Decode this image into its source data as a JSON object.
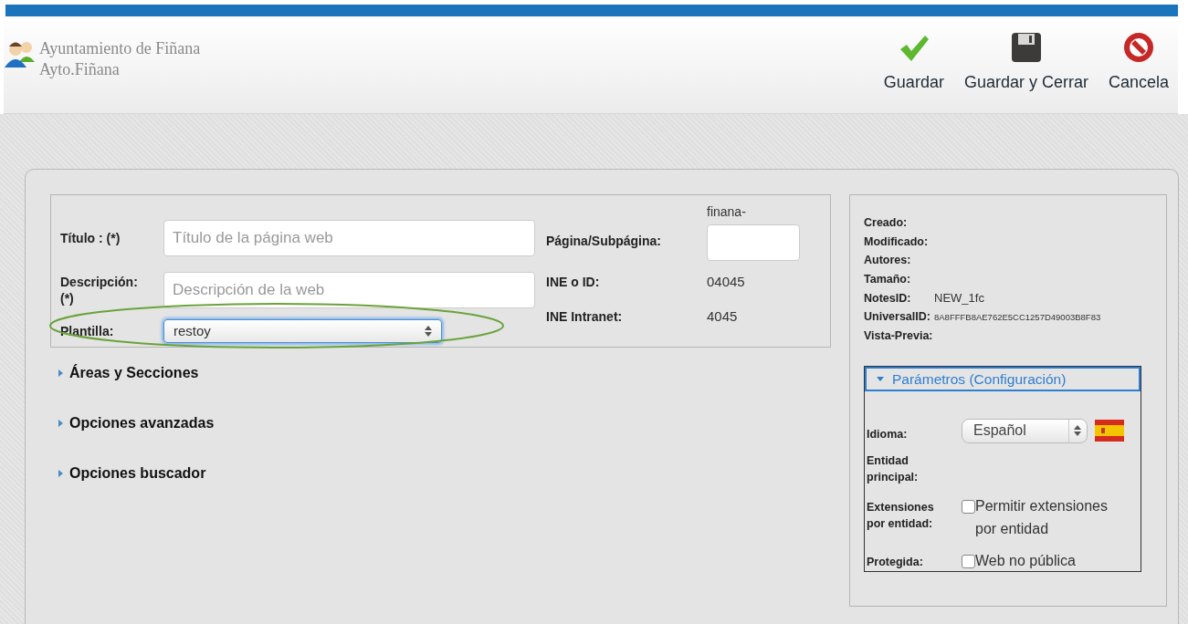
{
  "header": {
    "org_name": "Ayuntamiento de Fiñana",
    "org_short": "Ayto.Fiñana",
    "actions": [
      {
        "kind": "save",
        "label": "Guardar"
      },
      {
        "kind": "save_close",
        "label": "Guardar y Cerrar"
      },
      {
        "kind": "cancel",
        "label": "Cancela"
      }
    ]
  },
  "form": {
    "fields": [
      {
        "kind": "text",
        "label": "Título : (*)",
        "placeholder": "Título de la página web"
      },
      {
        "kind": "text",
        "label": "Descripción: (*)",
        "placeholder": "Descripción de la web"
      },
      {
        "kind": "select",
        "label": "Plantilla:",
        "value": "restoy",
        "highlighted": true
      }
    ],
    "side_fields": [
      {
        "kind": "input",
        "label": "Página/Subpágina:",
        "prefix": "finana-"
      },
      {
        "kind": "value",
        "label": "INE o ID:",
        "value": "04045"
      },
      {
        "kind": "value",
        "label": "INE Intranet:",
        "value": "4045"
      }
    ]
  },
  "sections": [
    {
      "label": "Áreas y Secciones",
      "expanded": false
    },
    {
      "label": "Opciones avanzadas",
      "expanded": false
    },
    {
      "label": "Opciones buscador",
      "expanded": false
    }
  ],
  "info": [
    {
      "label": "Creado:"
    },
    {
      "label": "Modificado:"
    },
    {
      "label": "Autores:"
    },
    {
      "label": "Tamaño:"
    },
    {
      "label": "NotesID:",
      "value": "NEW_1fc"
    },
    {
      "label": "UniversalID:",
      "value": "8A8FFFB8AE762E5CC1257D49003B8F83",
      "small": true
    },
    {
      "label": "Vista-Previa:"
    }
  ],
  "parameters": {
    "title": "Parámetros (Configuración)",
    "expanded": true,
    "rows": [
      {
        "kind": "select",
        "label": "Idioma:",
        "value": "Español"
      },
      {
        "kind": "empty",
        "label": "Entidad principal:"
      },
      {
        "kind": "checkbox",
        "label": "Extensiones por entidad:",
        "text": "Permitir extensiones por entidad",
        "checked": false
      },
      {
        "kind": "checkbox",
        "label": "Protegida:",
        "text": "Web no pública",
        "checked": false
      }
    ]
  }
}
